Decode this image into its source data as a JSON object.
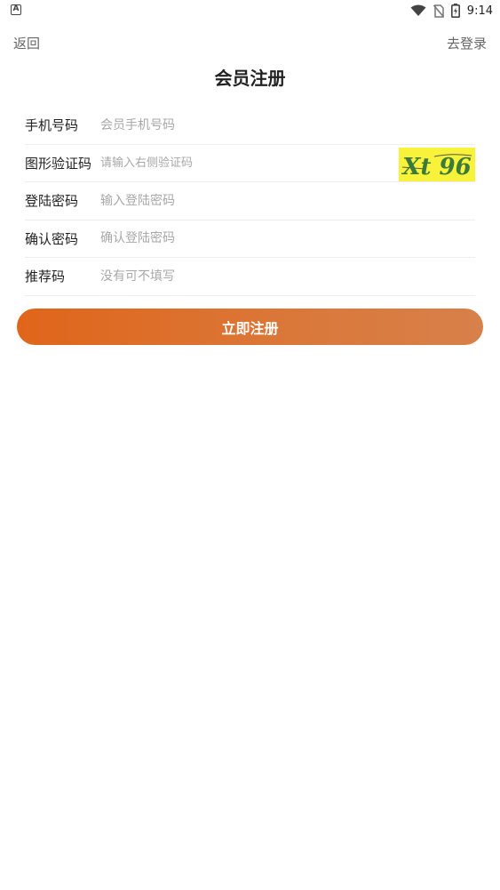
{
  "status_bar": {
    "time": "9:14",
    "left_icon_glyph": "A",
    "icons": [
      "wifi-icon",
      "no-sim-icon",
      "battery-charging-icon"
    ]
  },
  "nav": {
    "back_label": "返回",
    "login_label": "去登录"
  },
  "page": {
    "title": "会员注册"
  },
  "form": {
    "fields": [
      {
        "label": "手机号码",
        "placeholder": "会员手机号码"
      },
      {
        "label": "图形验证码",
        "placeholder": "请输入右侧验证码"
      },
      {
        "label": "登陆密码",
        "placeholder": "输入登陆密码"
      },
      {
        "label": "确认密码",
        "placeholder": "确认登陆密码"
      },
      {
        "label": "推荐码",
        "placeholder": "没有可不填写"
      }
    ],
    "captcha_text": "Xt 96",
    "captcha_colors": {
      "background": "#f8f23a",
      "text": "#3a7a3a"
    }
  },
  "submit": {
    "label": "立即注册",
    "color": "#e0651a"
  }
}
